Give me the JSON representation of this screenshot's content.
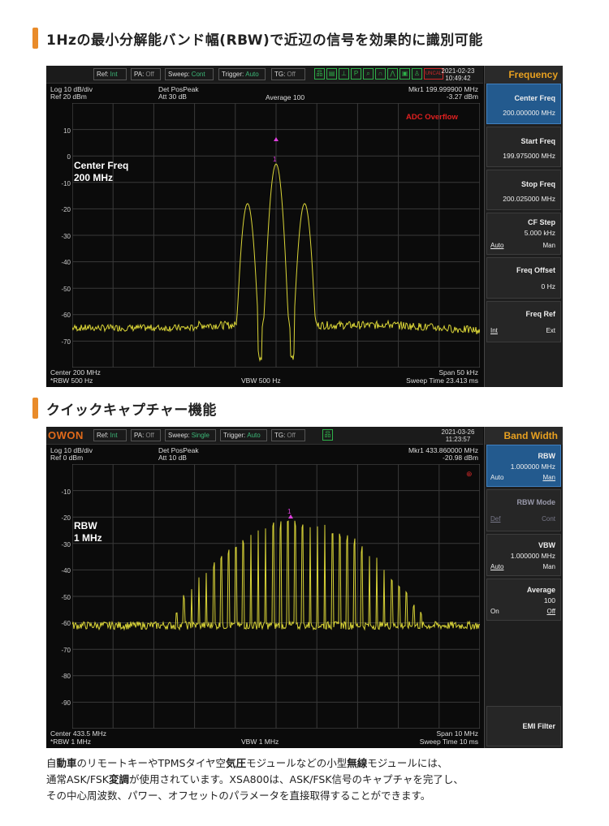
{
  "section1": {
    "title": "1Hzの最小分解能バンド幅(RBW)で近辺の信号を効果的に識別可能"
  },
  "section2": {
    "title": "クイックキャプチャー機能"
  },
  "screen1": {
    "status": {
      "ref_k": "Ref:",
      "ref_v": "Int",
      "pa_k": "PA:",
      "pa_v": "Off",
      "sweep_k": "Sweep:",
      "sweep_v": "Cont",
      "trig_k": "Trigger:",
      "trig_v": "Auto",
      "tg_k": "TG:",
      "tg_v": "Off",
      "date": "2021-02-23",
      "time": "10:49:42",
      "uncal": "UNCAL"
    },
    "icons": [
      "network-icon",
      "display-icon",
      "ruler-icon",
      "pass-icon",
      "search-icon",
      "headphones-icon",
      "peak-icon",
      "lock-icon",
      "person-icon",
      "uncal-icon"
    ],
    "menu": {
      "title": "Frequency",
      "center": {
        "label": "Center Freq",
        "value": "200.000000 MHz"
      },
      "start": {
        "label": "Start Freq",
        "value": "199.975000 MHz"
      },
      "stop": {
        "label": "Stop Freq",
        "value": "200.025000 MHz"
      },
      "cfstep": {
        "label": "CF Step",
        "value": "5.000 kHz",
        "left": "Auto",
        "right": "Man"
      },
      "offset": {
        "label": "Freq Offset",
        "value": "0 Hz"
      },
      "ref": {
        "label": "Freq Ref",
        "left": "Int",
        "right": "Ext"
      }
    },
    "info": {
      "scale": "Log 10 dB/div",
      "ref": "Ref 20 dBm",
      "det": "Det PosPeak",
      "att": "Att 30 dB",
      "avg": "Average 100",
      "mkr": "Mkr1  199.999900 MHz",
      "mkr_val": "-3.27 dBm",
      "overflow": "ADC Overflow",
      "center": "Center 200 MHz",
      "rbw": "*RBW 500 Hz",
      "vbw": "VBW 500 Hz",
      "span": "Span 50 kHz",
      "sweep": "Sweep Time 23.413 ms",
      "ann1": "Center Freq",
      "ann2": "200 MHz",
      "marker": "1"
    },
    "ylabels": [
      "10",
      "0",
      "-10",
      "-20",
      "-30",
      "-40",
      "-50",
      "-60",
      "-70"
    ]
  },
  "screen2": {
    "logo": "OWON",
    "status": {
      "ref_k": "Ref:",
      "ref_v": "Int",
      "pa_k": "PA:",
      "pa_v": "Off",
      "sweep_k": "Sweep:",
      "sweep_v": "Single",
      "trig_k": "Trigger:",
      "trig_v": "Auto",
      "tg_k": "TG:",
      "tg_v": "Off",
      "date": "2021-03-26",
      "time": "11:23:57"
    },
    "menu": {
      "title": "Band Width",
      "rbw": {
        "label": "RBW",
        "value": "1.000000 MHz",
        "left": "Auto",
        "right": "Man"
      },
      "rbwmode": {
        "label": "RBW Mode",
        "left": "Def",
        "right": "Cont"
      },
      "vbw": {
        "label": "VBW",
        "value": "1.000000 MHz",
        "left": "Auto",
        "right": "Man"
      },
      "average": {
        "label": "Average",
        "value": "100",
        "left": "On",
        "right": "Off"
      },
      "emi": {
        "label": "EMI Filter"
      }
    },
    "info": {
      "scale": "Log 10 dB/div",
      "ref": "Ref 0 dBm",
      "det": "Det PosPeak",
      "att": "Att 10 dB",
      "mkr": "Mkr1  433.860000 MHz",
      "mkr_val": "-20.98 dBm",
      "center": "Center 433.5 MHz",
      "rbw": "*RBW 1 MHz",
      "vbw": "VBW 1 MHz",
      "span": "Span 10 MHz",
      "sweep": "Sweep Time 10 ms",
      "ann1": "RBW",
      "ann2": "1 MHz",
      "marker": "1"
    },
    "ylabels": [
      "-10",
      "-20",
      "-30",
      "-40",
      "-50",
      "-60",
      "-70",
      "-80",
      "-90"
    ]
  },
  "caption": {
    "l1a": "自",
    "l1b": "動車",
    "l1c": "のリモートキーやTPMSタイヤ空",
    "l1d": "気圧",
    "l1e": "モジュールなどの小型",
    "l1f": "無線",
    "l1g": "モジュールには、",
    "l2a": "通常ASK/FSK",
    "l2b": "変調",
    "l2c": "が使用されています。XSA800は、ASK/FSK信号のキャプチャを完了し、",
    "l3": "その中心周波数、パワー、オフセットのパラメータを直接取得することができます。"
  },
  "colors": {
    "accent": "#e98b2a",
    "trace": "#d9d437",
    "grid": "#3a3a3a",
    "menu_title": "#e8a020",
    "active": "#235a8e"
  }
}
